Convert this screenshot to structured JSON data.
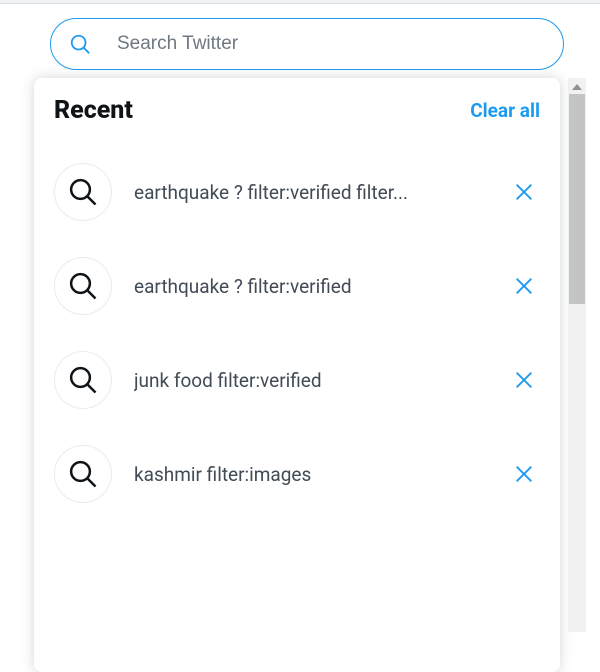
{
  "search": {
    "placeholder": "Search Twitter",
    "value": ""
  },
  "dropdown": {
    "title": "Recent",
    "clear_label": "Clear all",
    "items": [
      {
        "text": "earthquake ? filter:verified filter..."
      },
      {
        "text": "earthquake ? filter:verified"
      },
      {
        "text": "junk food filter:verified"
      },
      {
        "text": "kashmir filter:images"
      }
    ]
  },
  "colors": {
    "accent": "#1d9bf0",
    "text": "#0f1419"
  }
}
